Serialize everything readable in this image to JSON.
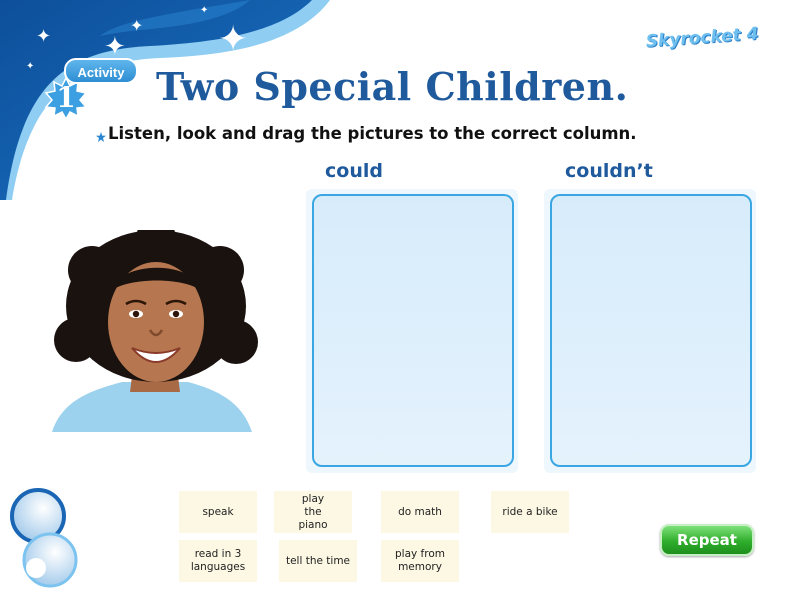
{
  "header": {
    "activity_label": "Activity",
    "activity_number": "1",
    "title": "Two Special Children.",
    "brand": "Skyrocket 4"
  },
  "instruction": "Listen, look and drag the pictures to the correct column.",
  "columns": [
    {
      "label": "could"
    },
    {
      "label": "couldn’t"
    }
  ],
  "cards": [
    {
      "label": "speak"
    },
    {
      "label": "play the piano"
    },
    {
      "label": "do math"
    },
    {
      "label": "ride a bike"
    },
    {
      "label": "read in 3 languages"
    },
    {
      "label": "tell the time"
    },
    {
      "label": "play from memory"
    }
  ],
  "buttons": {
    "repeat": "Repeat"
  },
  "colors": {
    "title_blue": "#1f5a9c",
    "header_blue": "#0f5fae",
    "column_border": "#3aa6e2",
    "card_bg": "#fcf8e4",
    "repeat_green": "#2fae2c"
  }
}
